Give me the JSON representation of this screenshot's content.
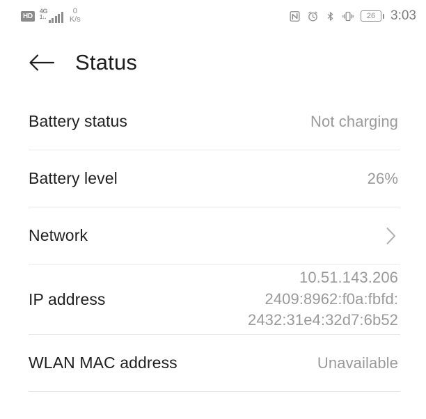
{
  "statusbar": {
    "hd_badge": "HD",
    "network_gen": "4G",
    "network_sub": "1↓.",
    "netspeed_value": "0",
    "netspeed_unit": "K/s",
    "icons": [
      "nfc-icon",
      "alarm-icon",
      "bluetooth-icon",
      "vibrate-icon"
    ],
    "battery_level": "26",
    "clock": "3:03"
  },
  "header": {
    "back_label": "back-arrow",
    "title": "Status"
  },
  "rows": [
    {
      "label": "Battery status",
      "value": "Not charging",
      "type": "value"
    },
    {
      "label": "Battery level",
      "value": "26%",
      "type": "value"
    },
    {
      "label": "Network",
      "value": "",
      "type": "chevron"
    },
    {
      "label": "IP address",
      "value": "10.51.143.206\n2409:8962:f0a:fbfd:\n2432:31e4:32d7:6b52",
      "type": "multiline"
    },
    {
      "label": "WLAN MAC address",
      "value": "Unavailable",
      "type": "value"
    }
  ],
  "colors": {
    "background": "#ffffff",
    "primary_text": "#1f1f1f",
    "secondary_text": "#9a9a9a",
    "divider": "#e8e8e8",
    "status_icon": "#8b8b8b"
  }
}
